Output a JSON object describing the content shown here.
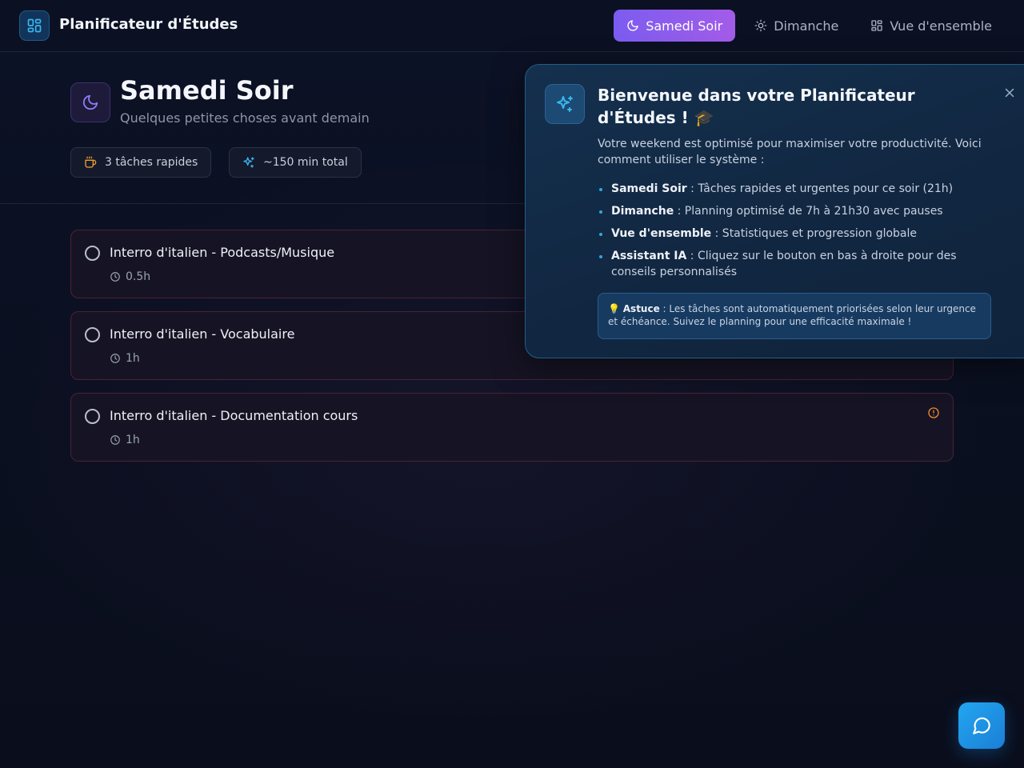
{
  "header": {
    "app_title": "Planificateur d'Études",
    "logo_icon": "dashboard-grid-icon",
    "tabs": [
      {
        "label": "Samedi Soir",
        "icon": "moon-icon",
        "active": true
      },
      {
        "label": "Dimanche",
        "icon": "sun-icon",
        "active": false
      },
      {
        "label": "Vue d'ensemble",
        "icon": "grid-icon",
        "active": false
      }
    ]
  },
  "hero": {
    "icon": "moon-icon",
    "title": "Samedi Soir",
    "subtitle": "Quelques petites choses avant demain",
    "chips": [
      {
        "label": "3 tâches rapides",
        "icon": "coffee-icon"
      },
      {
        "label": "~150 min total",
        "icon": "sparkles-icon"
      }
    ]
  },
  "tasks": [
    {
      "title": "Interro d'italien - Podcasts/Musique",
      "duration": "0.5h"
    },
    {
      "title": "Interro d'italien - Vocabulaire",
      "duration": "1h"
    },
    {
      "title": "Interro d'italien - Documentation cours",
      "duration": "1h",
      "alert_icon": "alert-circle-icon"
    }
  ],
  "welcome": {
    "icon": "sparkles-icon",
    "title": "Bienvenue dans votre Planificateur d'Études ! 🎓",
    "intro": "Votre weekend est optimisé pour maximiser votre productivité. Voici comment utiliser le système :",
    "items": [
      {
        "label": "Samedi Soir",
        "text": " : Tâches rapides et urgentes pour ce soir (21h)"
      },
      {
        "label": "Dimanche",
        "text": " : Planning optimisé de 7h à 21h30 avec pauses"
      },
      {
        "label": "Vue d'ensemble",
        "text": " : Statistiques et progression globale"
      },
      {
        "label": "Assistant IA",
        "text": " : Cliquez sur le bouton en bas à droite pour des conseils personnalisés"
      }
    ],
    "tip_prefix": "💡 ",
    "tip_label": "Astuce",
    "tip_text": " : Les tâches sont automatiquement priorisées selon leur urgence et échéance. Suivez le planning pour une efficacité maximale !"
  },
  "chat": {
    "icon": "message-circle-icon"
  },
  "colors": {
    "accent": "#7b5cf0",
    "info": "#2fa8e0",
    "alert": "#f08a2c"
  }
}
